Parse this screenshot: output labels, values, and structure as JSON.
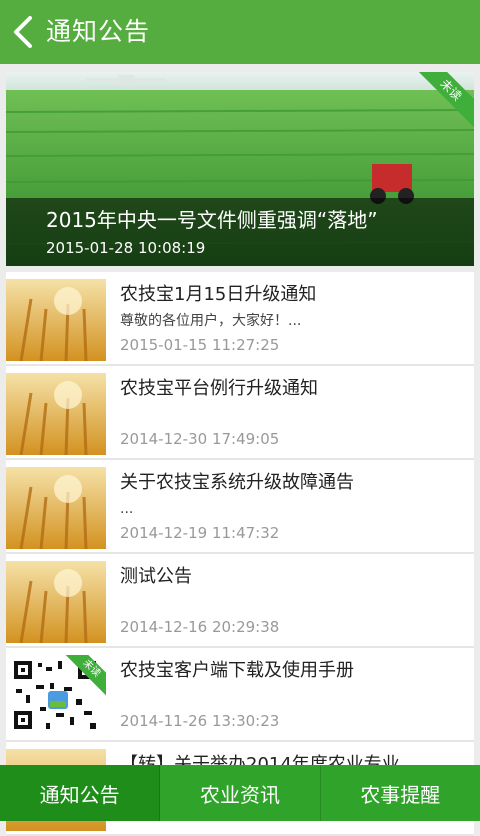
{
  "header": {
    "title": "通知公告"
  },
  "feature": {
    "title": "2015年中央一号文件侧重强调“落地”",
    "time": "2015-01-28 10:08:19",
    "badge": "未读"
  },
  "items": [
    {
      "title": "农技宝1月15日升级通知",
      "summary": "尊敬的各位用户，大家好！...",
      "time": "2015-01-15 11:27:25",
      "thumb": "wheat"
    },
    {
      "title": "农技宝平台例行升级通知",
      "summary": "",
      "time": "2014-12-30 17:49:05",
      "thumb": "wheat"
    },
    {
      "title": "关于农技宝系统升级故障通告",
      "summary": "...",
      "time": "2014-12-19 11:47:32",
      "thumb": "wheat"
    },
    {
      "title": "测试公告",
      "summary": "",
      "time": "2014-12-16 20:29:38",
      "thumb": "wheat"
    },
    {
      "title": "农技宝客户端下载及使用手册",
      "summary": "",
      "time": "2014-11-26 13:30:23",
      "thumb": "qr",
      "badge": "未读"
    },
    {
      "title": "【转】关于举办2014年度农业专业",
      "summary": "",
      "time": "",
      "thumb": "wheat"
    }
  ],
  "tabs": [
    {
      "label": "通知公告",
      "active": true
    },
    {
      "label": "农业资讯",
      "active": false
    },
    {
      "label": "农事提醒",
      "active": false
    }
  ],
  "colors": {
    "header": "#56ad3f",
    "tab_bar": "#2fa32a",
    "tab_active": "#1e8d1a"
  }
}
